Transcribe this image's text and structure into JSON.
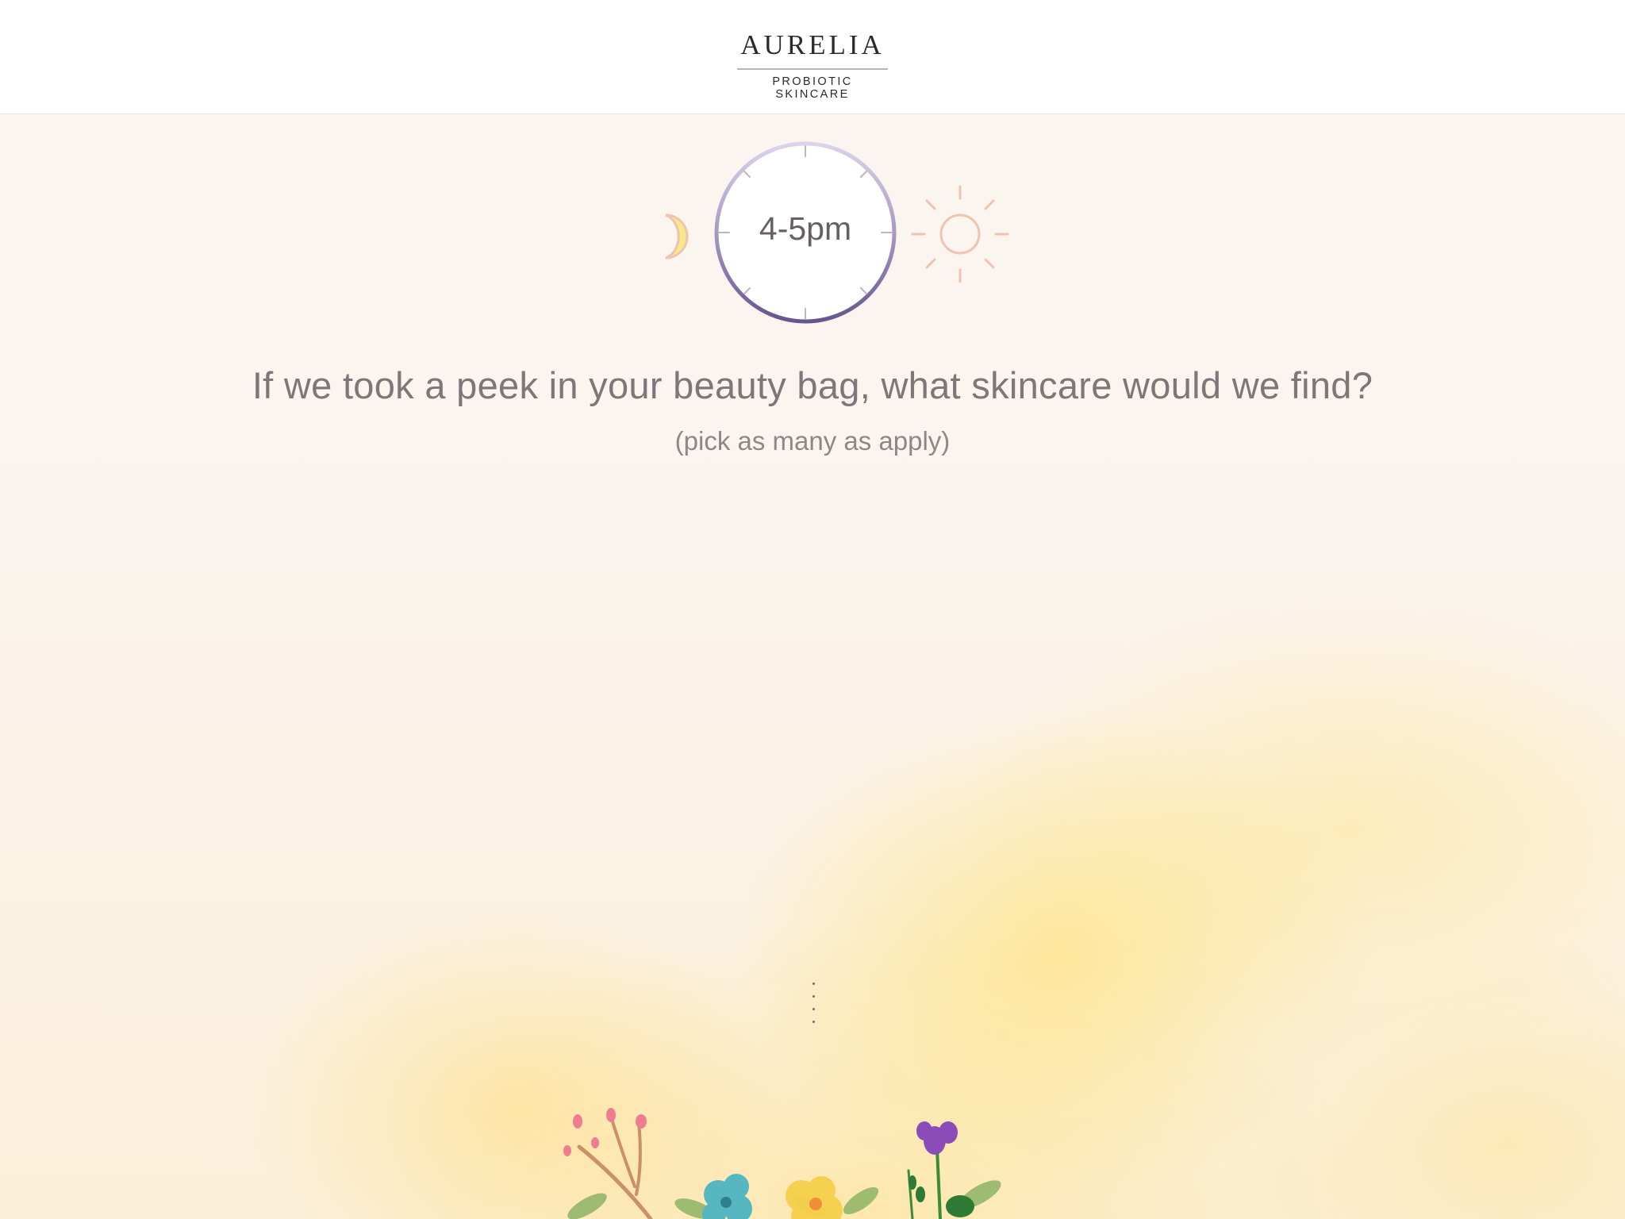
{
  "brand": {
    "name": "AURELIA",
    "tagline": "PROBIOTIC SKINCARE"
  },
  "timer": {
    "label": "4-5pm",
    "moon_icon": "crescent-moon-icon",
    "sun_icon": "sun-icon",
    "ring_color_start": "#d8cde6",
    "ring_color_end": "#6b5b94"
  },
  "question": {
    "text": "If we took a peek in your beauty bag, what skincare would we find?",
    "hint": "(pick as many as apply)"
  },
  "colors": {
    "background": "#fbf6f2",
    "watercolor": "#ffe27a",
    "text": "#7d7779",
    "icon_accent": "#f0c2b0"
  }
}
